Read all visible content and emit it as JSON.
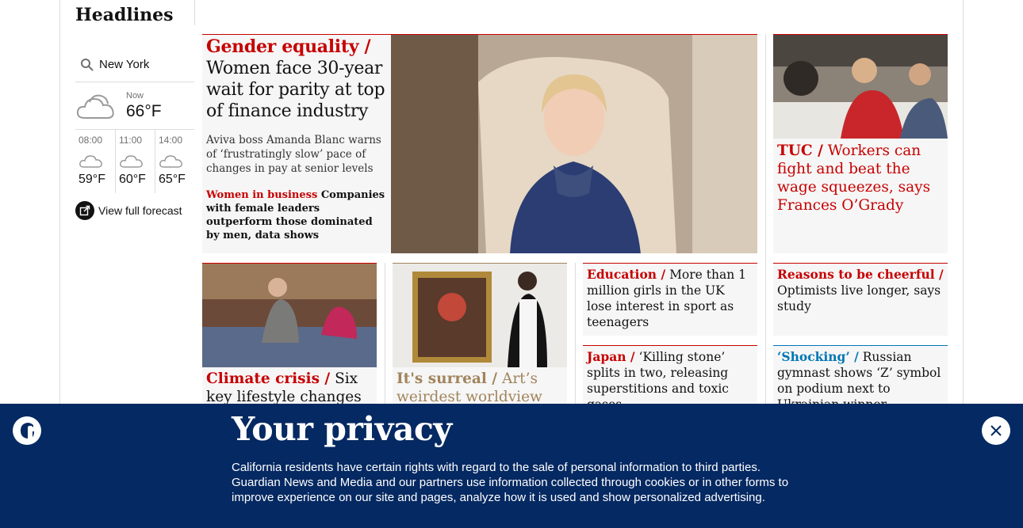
{
  "section": {
    "title": "Headlines"
  },
  "weather": {
    "location": "New York",
    "now_label": "Now",
    "now_temp": "66°F",
    "forecast": [
      {
        "time": "08:00",
        "temp": "59°F",
        "icon": "cloud-icon"
      },
      {
        "time": "11:00",
        "temp": "60°F",
        "icon": "cloud-icon"
      },
      {
        "time": "14:00",
        "temp": "65°F",
        "icon": "cloud-icon"
      }
    ],
    "full_forecast": "View full forecast"
  },
  "lead": {
    "kicker": "Gender equality /",
    "headline": "Women face 30-year wait for parity at top of finance industry",
    "standfirst": "Aviva boss Amanda Blanc warns of ‘frustratingly slow’ pace of changes in pay at senior levels",
    "sub_kicker": "Women in business",
    "sub_headline": "Companies with female leaders outperform those dominated by men, data shows"
  },
  "tuc": {
    "kicker": "TUC /",
    "headline": "Workers can fight and beat the wage squeezes, says Frances O’Grady"
  },
  "cards": {
    "climate": {
      "kicker": "Climate crisis /",
      "headline": "Six key lifestyle changes can"
    },
    "surreal": {
      "kicker": "It's surreal /",
      "headline": "Art’s weirdest worldview"
    },
    "education": {
      "kicker": "Education /",
      "headline": "More than 1 million girls in the UK lose interest in sport as teenagers"
    },
    "cheerful": {
      "kicker": "Reasons to be cheerful /",
      "headline": "Optimists live longer, says study"
    },
    "japan": {
      "kicker": "Japan /",
      "headline": "‘Killing stone’ splits in two, releasing superstitions and toxic gases"
    },
    "shocking": {
      "kicker": "‘Shocking’ /",
      "headline": "Russian gymnast shows ‘Z’ symbol on podium next to Ukrainian winner"
    }
  },
  "privacy": {
    "title": "Your privacy",
    "text": "California residents have certain rights with regard to the sale of personal information to third parties. Guardian News and Media and our partners use information collected through cookies or in other forms to improve experience on our site and pages, analyze how it is used and show personalized advertising."
  },
  "colors": {
    "news_red": "#c70000",
    "banner_blue": "#052962",
    "sport_blue": "#0077b6",
    "culture_gold": "#a1845c"
  }
}
